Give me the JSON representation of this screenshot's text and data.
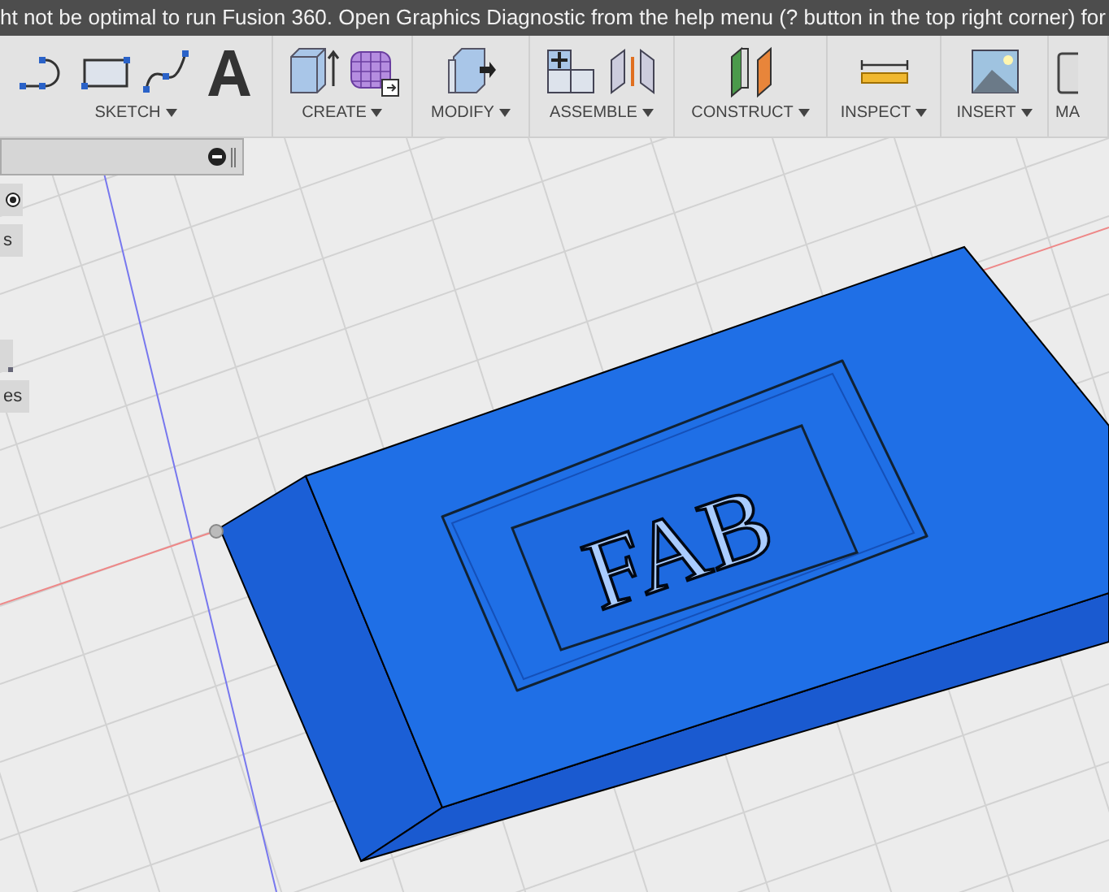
{
  "banner": {
    "text": "ht not be optimal to run Fusion 360. Open Graphics Diagnostic from the help menu (? button in the top right corner) for"
  },
  "toolbar": {
    "groups": [
      {
        "label": "SKETCH",
        "dropdown": true
      },
      {
        "label": "CREATE",
        "dropdown": true
      },
      {
        "label": "MODIFY",
        "dropdown": true
      },
      {
        "label": "ASSEMBLE",
        "dropdown": true
      },
      {
        "label": "CONSTRUCT",
        "dropdown": true
      },
      {
        "label": "INSPECT",
        "dropdown": true
      },
      {
        "label": "INSERT",
        "dropdown": true
      },
      {
        "label": "MA",
        "dropdown": false
      }
    ]
  },
  "side_items": [
    {
      "kind": "icon",
      "checked": true
    },
    {
      "kind": "text",
      "label": "s"
    },
    {
      "kind": "icon"
    },
    {
      "kind": "text",
      "label": "es"
    }
  ],
  "model": {
    "embossed_text": "FAB"
  }
}
